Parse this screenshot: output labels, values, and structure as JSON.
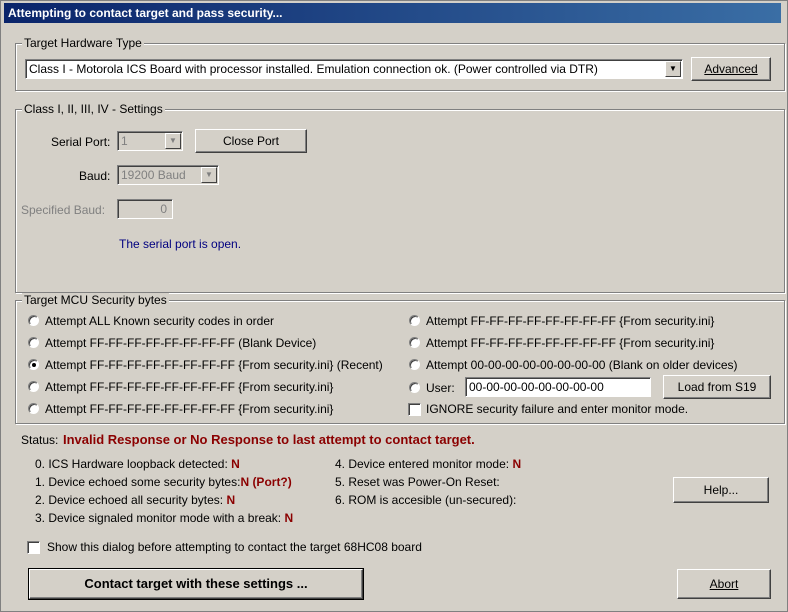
{
  "window": {
    "title": "Attempting to contact target and pass security..."
  },
  "hardware": {
    "legend": "Target Hardware Type",
    "selected": "Class I - Motorola ICS Board with processor installed. Emulation connection ok. (Power controlled via DTR)",
    "advanced_label": "Advanced"
  },
  "settings": {
    "legend": "Class I, II, III, IV - Settings",
    "serial_port_label": "Serial Port:",
    "serial_port_value": "1",
    "close_port_label": "Close Port",
    "baud_label": "Baud:",
    "baud_value": "19200 Baud",
    "specified_baud_label": "Specified Baud:",
    "specified_baud_value": "0",
    "port_status": "The serial port is open."
  },
  "security": {
    "legend": "Target MCU Security bytes",
    "left_options": [
      {
        "label": "Attempt ALL Known security codes in order",
        "selected": false
      },
      {
        "label": "Attempt FF-FF-FF-FF-FF-FF-FF-FF (Blank Device)",
        "selected": false
      },
      {
        "label": "Attempt FF-FF-FF-FF-FF-FF-FF-FF {From security.ini} (Recent)",
        "selected": true
      },
      {
        "label": "Attempt FF-FF-FF-FF-FF-FF-FF-FF {From security.ini}",
        "selected": false
      },
      {
        "label": "Attempt FF-FF-FF-FF-FF-FF-FF-FF {From security.ini}",
        "selected": false
      }
    ],
    "right_options": [
      {
        "label": "Attempt FF-FF-FF-FF-FF-FF-FF-FF {From security.ini}",
        "selected": false
      },
      {
        "label": "Attempt FF-FF-FF-FF-FF-FF-FF-FF {From security.ini}",
        "selected": false
      },
      {
        "label": "Attempt 00-00-00-00-00-00-00-00 (Blank on older devices)",
        "selected": false
      }
    ],
    "user_label": "User:",
    "user_value": "00-00-00-00-00-00-00-00",
    "load_button": "Load from S19",
    "ignore_label": "IGNORE security failure and enter monitor mode.",
    "ignore_checked": false
  },
  "status": {
    "label": "Status:",
    "message": "Invalid Response or No Response to last attempt to contact target.",
    "items_left": [
      {
        "text": "0. ICS Hardware loopback detected:",
        "value": "N"
      },
      {
        "text": "1. Device echoed some security bytes:",
        "value": "N (Port?)"
      },
      {
        "text": "2. Device echoed all security bytes:",
        "value": "N"
      },
      {
        "text": "3. Device signaled monitor mode with a break:",
        "value": "N"
      }
    ],
    "items_right": [
      {
        "text": "4. Device entered monitor mode:",
        "value": "N"
      },
      {
        "text": "5. Reset was Power-On Reset:",
        "value": ""
      },
      {
        "text": "6. ROM is accesible (un-secured):",
        "value": ""
      }
    ],
    "help_label": "Help..."
  },
  "footer": {
    "show_dialog_label": "Show this dialog before attempting to contact the target 68HC08 board",
    "show_dialog_checked": false,
    "contact_label": "Contact target with these settings ...",
    "abort_label": "Abort"
  }
}
